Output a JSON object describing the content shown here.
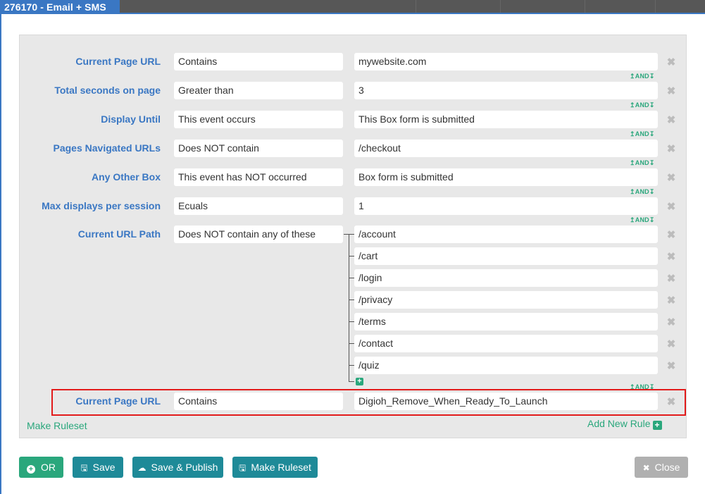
{
  "window": {
    "title": "276170 - Email + SMS"
  },
  "rules": [
    {
      "label": "Current Page URL",
      "operator": "Contains",
      "value": "mywebsite.com",
      "connector": "AND"
    },
    {
      "label": "Total seconds on page",
      "operator": "Greater than",
      "value": "3",
      "connector": "AND"
    },
    {
      "label": "Display Until",
      "operator": "This event occurs",
      "value": "This Box form is submitted",
      "connector": "AND"
    },
    {
      "label": "Pages Navigated URLs",
      "operator": "Does NOT contain",
      "value": "/checkout",
      "connector": "AND"
    },
    {
      "label": "Any Other Box",
      "operator": "This event has NOT occurred",
      "value": "Box form is submitted",
      "connector": "AND"
    },
    {
      "label": "Max displays per session",
      "operator": "Ecuals",
      "value": "1",
      "connector": "AND"
    },
    {
      "label": "Current URL Path",
      "operator": "Does NOT contain any of these",
      "values": [
        "/account",
        "/cart",
        "/login",
        "/privacy",
        "/terms",
        "/contact",
        "/quiz"
      ],
      "connector": "AND"
    },
    {
      "label": "Current Page URL",
      "operator": "Contains",
      "value": "Digioh_Remove_When_Ready_To_Launch"
    }
  ],
  "links": {
    "make_ruleset": "Make Ruleset",
    "add_new_rule": "Add New Rule"
  },
  "buttons": {
    "or": "OR",
    "save": "Save",
    "save_publish": "Save & Publish",
    "make_ruleset": "Make Ruleset",
    "close": "Close"
  },
  "colors": {
    "accent_blue": "#3a77c3",
    "accent_green": "#2aa77c",
    "button_teal": "#1e8a98",
    "highlight_red": "#e21b1b",
    "close_gray": "#b0b0b0"
  },
  "icons": {
    "remove": "close-icon",
    "and_connector": "and-arrows-icon",
    "add": "plus-icon",
    "save": "floppy-icon",
    "publish": "cloud-upload-icon"
  }
}
